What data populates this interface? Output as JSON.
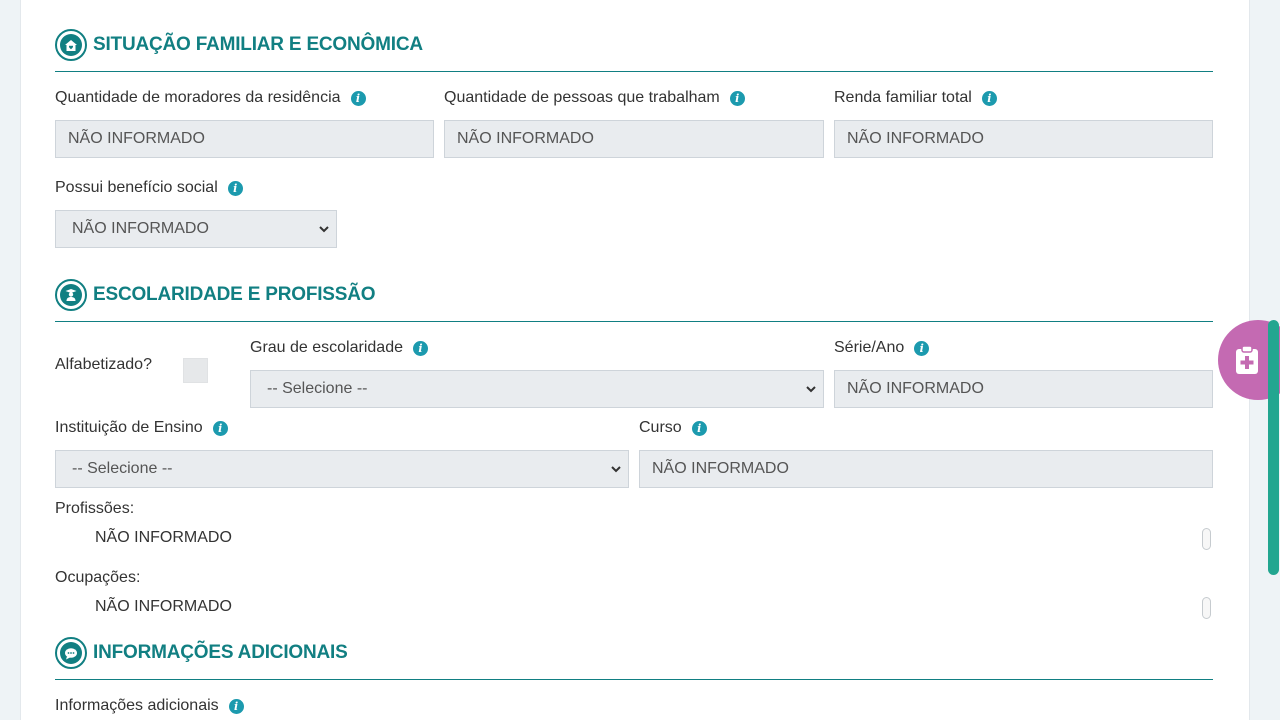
{
  "sections": {
    "familiar": {
      "title": "SITUAÇÃO FAMILIAR E ECONÔMICA",
      "fields": {
        "moradores": {
          "label": "Quantidade de moradores da residência",
          "value": "NÃO INFORMADO"
        },
        "trabalham": {
          "label": "Quantidade de pessoas que trabalham",
          "value": "NÃO INFORMADO"
        },
        "renda": {
          "label": "Renda familiar total",
          "value": "NÃO INFORMADO"
        },
        "beneficio": {
          "label": "Possui benefício social",
          "value": "NÃO INFORMADO"
        }
      }
    },
    "escolaridade": {
      "title": "ESCOLARIDADE E PROFISSÃO",
      "fields": {
        "alfabetizado": {
          "label": "Alfabetizado?"
        },
        "grau": {
          "label": "Grau de escolaridade",
          "value": "-- Selecione --"
        },
        "serie": {
          "label": "Série/Ano",
          "value": "NÃO INFORMADO"
        },
        "instituicao": {
          "label": "Instituição de Ensino",
          "value": "-- Selecione --"
        },
        "curso": {
          "label": "Curso",
          "value": "NÃO INFORMADO"
        },
        "profissoes": {
          "label": "Profissões:",
          "value": "NÃO INFORMADO"
        },
        "ocupacoes": {
          "label": "Ocupações:",
          "value": "NÃO INFORMADO"
        }
      }
    },
    "adicionais": {
      "title": "INFORMAÇÕES ADICIONAIS",
      "fields": {
        "info": {
          "label": "Informações adicionais"
        }
      }
    }
  },
  "colors": {
    "accent": "#117f82",
    "info_icon": "#1c9aae",
    "fab": "#c46ab2",
    "scrollbar": "#22a690"
  },
  "icons": {
    "info": "i",
    "familiar_section": "house-heart-icon",
    "escolaridade_section": "graduate-icon",
    "adicionais_section": "chat-bubble-icon",
    "fab": "clipboard-plus-icon"
  }
}
